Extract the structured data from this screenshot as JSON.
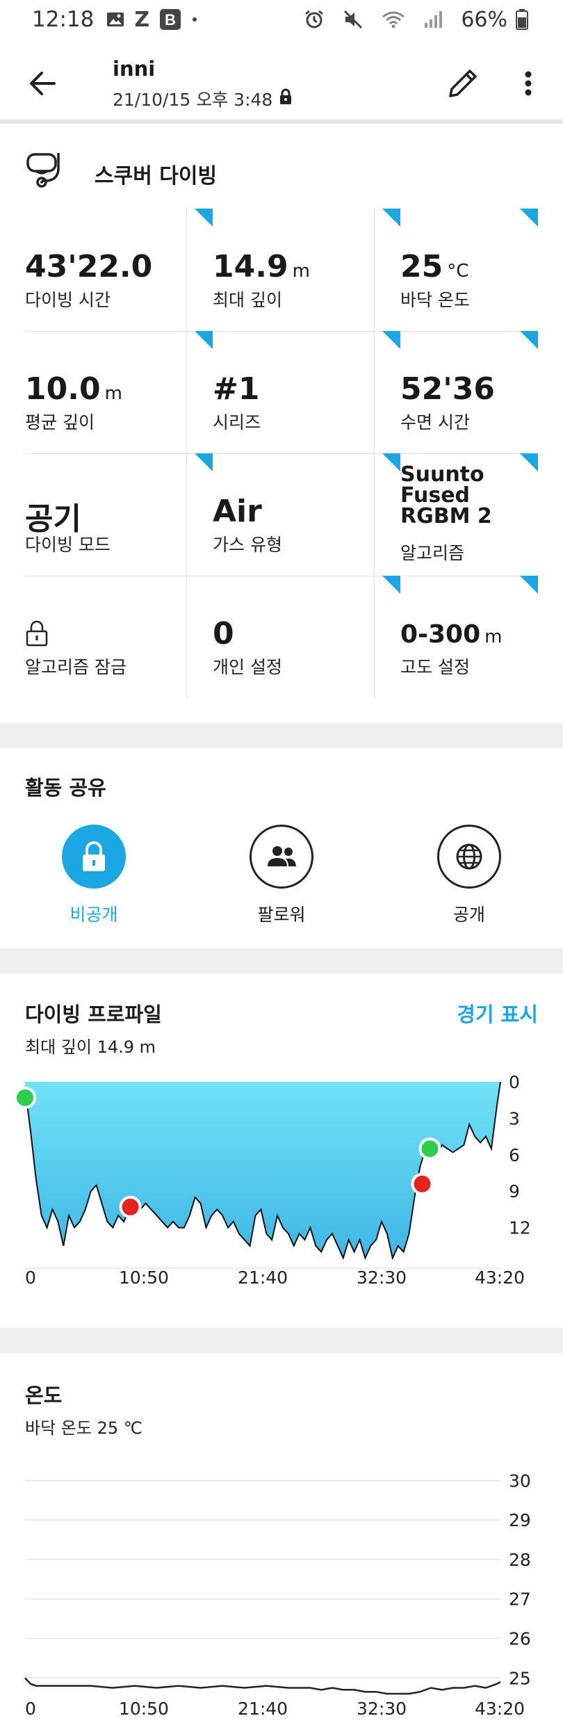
{
  "status_bar": {
    "time": "12:18",
    "battery": "66%"
  },
  "header": {
    "title": "inni",
    "subtitle": "21/10/15 오후 3:48"
  },
  "activity": {
    "label": "스쿠버 다이빙"
  },
  "stats": [
    {
      "value": "43'22.0",
      "unit": "",
      "label": "다이빙 시간"
    },
    {
      "value": "14.9",
      "unit": "m",
      "label": "최대 깊이"
    },
    {
      "value": "25",
      "unit": "°C",
      "label": "바닥 온도"
    },
    {
      "value": "10.0",
      "unit": "m",
      "label": "평균 깊이"
    },
    {
      "value": "#1",
      "unit": "",
      "label": "시리즈"
    },
    {
      "value": "52'36",
      "unit": "",
      "label": "수면 시간"
    },
    {
      "value": "공기",
      "unit": "",
      "label": "다이빙 모드"
    },
    {
      "value": "Air",
      "unit": "",
      "label": "가스 유형"
    },
    {
      "value": "Suunto Fused RGBM 2",
      "unit": "",
      "label": "알고리즘"
    },
    {
      "value": "",
      "unit": "",
      "label": "알고리즘 잠금"
    },
    {
      "value": "0",
      "unit": "",
      "label": "개인 설정"
    },
    {
      "value": "0-300",
      "unit": "m",
      "label": "고도 설정"
    }
  ],
  "sharing": {
    "title": "활동 공유",
    "options": [
      {
        "label": "비공개",
        "icon": "lock-icon",
        "selected": true
      },
      {
        "label": "팔로워",
        "icon": "people-icon",
        "selected": false
      },
      {
        "label": "공개",
        "icon": "globe-icon",
        "selected": false
      }
    ]
  },
  "colors": {
    "accent": "#1aa7e3",
    "profile_fill_top": "#6fe3f7",
    "profile_fill_bottom": "#3fb6e6",
    "marker_green": "#2ecc4f",
    "marker_red": "#e52222"
  },
  "dive_profile": {
    "title": "다이빙 프로파일",
    "subtitle": "최대 깊이 14.9 m",
    "link": "경기 표시"
  },
  "temperature": {
    "title": "온도",
    "subtitle": "바닥 온도 25 ℃"
  },
  "chart_data": [
    {
      "type": "area",
      "title": "다이빙 프로파일",
      "x_tick_labels": [
        "0",
        "10:50",
        "21:40",
        "32:30",
        "43:20"
      ],
      "y_tick_labels": [
        "0",
        "3",
        "6",
        "9",
        "12"
      ],
      "xlim": [
        0,
        43.33
      ],
      "ylim": [
        0,
        15
      ],
      "y_inverted": true,
      "x_unit": "minutes",
      "y_unit": "m",
      "series": [
        {
          "x": [
            0,
            0.5,
            1,
            1.5,
            2,
            2.5,
            3,
            3.5,
            4,
            4.5,
            5,
            5.5,
            6,
            6.5,
            7,
            7.5,
            8,
            8.5,
            9,
            9.5,
            10,
            10.5,
            11,
            11.5,
            12,
            12.5,
            13,
            13.5,
            14,
            14.5,
            15,
            15.5,
            16,
            16.5,
            17,
            17.5,
            18,
            18.5,
            19,
            19.5,
            20,
            20.5,
            21,
            21.5,
            22,
            22.5,
            23,
            23.5,
            24,
            24.5,
            25,
            25.5,
            26,
            26.5,
            27,
            27.5,
            28,
            28.5,
            29,
            29.5,
            30,
            30.5,
            31,
            31.5,
            32,
            32.5,
            33,
            33.5,
            34,
            34.5,
            35,
            35.5,
            36,
            36.5,
            37,
            37.5,
            38,
            38.5,
            39,
            39.5,
            40,
            40.5,
            41,
            41.5,
            42,
            42.5,
            43,
            43.33
          ],
          "values": [
            0.5,
            4,
            8,
            11,
            12,
            10.5,
            11.5,
            13.5,
            11,
            12,
            11.5,
            10.5,
            9,
            8.5,
            10,
            11.5,
            12,
            11,
            11.5,
            10.5,
            10,
            10.5,
            10,
            10.5,
            11,
            11.5,
            12,
            11.5,
            12,
            12,
            11,
            9.5,
            10,
            12,
            11,
            10.5,
            11,
            12,
            11.5,
            12.5,
            13,
            13.5,
            11,
            10.5,
            12.5,
            13,
            11,
            12,
            12.5,
            13.5,
            12.5,
            13,
            12,
            13.5,
            14,
            13,
            12.5,
            13.5,
            14.5,
            13,
            14,
            13,
            14.5,
            13.5,
            13,
            11.5,
            12.5,
            14.5,
            13.5,
            14,
            12.5,
            9.5,
            7,
            5.5,
            5.8,
            6,
            5.2,
            5.5,
            5.8,
            5.5,
            5.2,
            3.5,
            4.5,
            5,
            4.5,
            5.5,
            2,
            0
          ],
          "name": ""
        }
      ],
      "markers": [
        {
          "x": 0,
          "y": 1.3,
          "color": "green"
        },
        {
          "x": 9.6,
          "y": 10.3,
          "color": "red"
        },
        {
          "x": 36.2,
          "y": 8.4,
          "color": "red"
        },
        {
          "x": 36.9,
          "y": 5.5,
          "color": "green"
        }
      ]
    },
    {
      "type": "line",
      "title": "온도",
      "x_tick_labels": [
        "0",
        "10:50",
        "21:40",
        "32:30",
        "43:20"
      ],
      "y_tick_labels": [
        "30",
        "29",
        "28",
        "27",
        "26",
        "25"
      ],
      "xlim": [
        0,
        43.33
      ],
      "ylim": [
        24.6,
        30.2
      ],
      "grid": true,
      "series": [
        {
          "x": [
            0,
            0.5,
            1,
            2,
            4,
            6,
            8,
            10,
            12,
            14,
            16,
            18,
            20,
            22,
            24,
            26,
            27,
            28,
            29,
            30,
            31,
            32,
            33,
            34,
            35,
            36,
            37,
            38,
            39,
            40,
            41,
            42,
            43,
            43.33
          ],
          "values": [
            25.0,
            24.85,
            24.8,
            24.8,
            24.8,
            24.8,
            24.75,
            24.8,
            24.75,
            24.8,
            24.75,
            24.8,
            24.75,
            24.8,
            24.75,
            24.75,
            24.7,
            24.75,
            24.7,
            24.7,
            24.65,
            24.65,
            24.6,
            24.6,
            24.6,
            24.65,
            24.75,
            24.7,
            24.75,
            24.75,
            24.8,
            24.75,
            24.85,
            24.9
          ],
          "name": ""
        }
      ]
    }
  ]
}
